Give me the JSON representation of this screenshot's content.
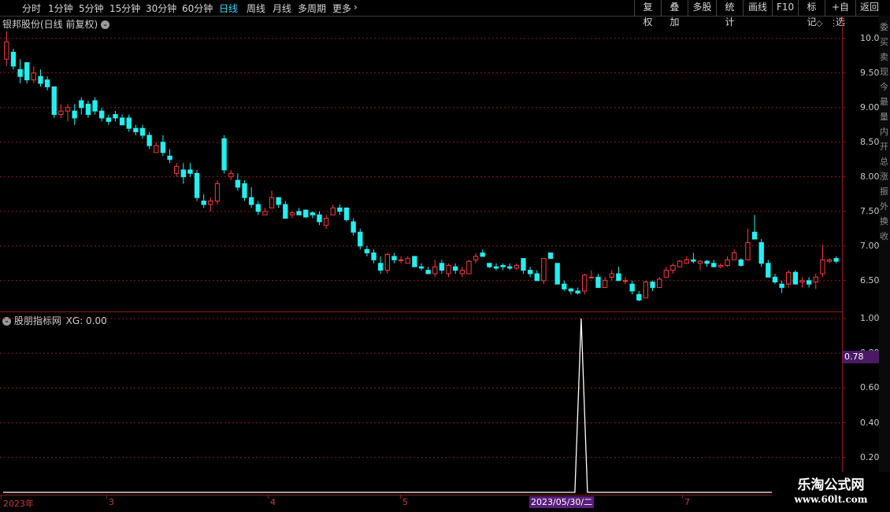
{
  "toolbar": {
    "left_items": [
      "分时",
      "1分钟",
      "5分钟",
      "15分钟",
      "30分钟",
      "60分钟",
      "日线",
      "周线",
      "月线",
      "多周期",
      "更多"
    ],
    "active": "日线",
    "more_arrow": "›",
    "right_items": [
      "复权",
      "叠加",
      "多股",
      "统计",
      "画线",
      "F10",
      "标记",
      "+自选",
      "返回"
    ]
  },
  "chart": {
    "title": "银邦股份(日线 前复权)",
    "price_ticks": [
      "10.00",
      "9.50",
      "9.00",
      "8.50",
      "8.00",
      "7.50",
      "7.00",
      "6.50"
    ],
    "indicator_title": "股朋指标网",
    "indicator_value": "XG: 0.00",
    "indicator_ticks": [
      "1.00",
      "0.80",
      "0.60",
      "0.40",
      "0.20"
    ],
    "indicator_current": "0.78",
    "x_labels": [
      "2023年",
      "3",
      "4",
      "5",
      "7"
    ],
    "highlight_date": "2023/05/30/二",
    "up_color": "#ff3c3c",
    "down_color": "#22f0f0",
    "grid_color": "#8a1e1e"
  },
  "chart_data": {
    "type": "candlestick",
    "price_range": [
      6.1,
      10.1
    ],
    "indicator_range": [
      0,
      1.0
    ],
    "candles": [
      [
        9.7,
        10.1,
        9.6,
        9.95
      ],
      [
        9.8,
        9.85,
        9.55,
        9.6
      ],
      [
        9.55,
        9.7,
        9.35,
        9.45
      ],
      [
        9.65,
        9.65,
        9.35,
        9.4
      ],
      [
        9.4,
        9.6,
        9.35,
        9.5
      ],
      [
        9.45,
        9.55,
        9.3,
        9.35
      ],
      [
        9.4,
        9.45,
        9.25,
        9.3
      ],
      [
        9.3,
        9.3,
        8.85,
        8.9
      ],
      [
        8.9,
        9.05,
        8.85,
        8.95
      ],
      [
        8.95,
        9.05,
        8.8,
        9.0
      ],
      [
        8.95,
        9.05,
        8.75,
        8.85
      ],
      [
        9.1,
        9.15,
        8.9,
        9.0
      ],
      [
        9.05,
        9.1,
        8.85,
        8.9
      ],
      [
        9.1,
        9.15,
        8.9,
        8.95
      ],
      [
        8.95,
        9.0,
        8.8,
        8.85
      ],
      [
        8.85,
        8.9,
        8.75,
        8.8
      ],
      [
        8.9,
        8.95,
        8.8,
        8.85
      ],
      [
        8.85,
        8.9,
        8.8,
        8.75
      ],
      [
        8.85,
        8.9,
        8.65,
        8.7
      ],
      [
        8.7,
        8.75,
        8.6,
        8.65
      ],
      [
        8.7,
        8.75,
        8.55,
        8.6
      ],
      [
        8.6,
        8.65,
        8.4,
        8.45
      ],
      [
        8.35,
        8.5,
        8.35,
        8.45
      ],
      [
        8.5,
        8.6,
        8.3,
        8.35
      ],
      [
        8.3,
        8.4,
        8.2,
        8.25
      ],
      [
        8.05,
        8.2,
        8.0,
        8.15
      ],
      [
        8.1,
        8.2,
        7.9,
        8.0
      ],
      [
        8.1,
        8.2,
        8.0,
        8.05
      ],
      [
        8.05,
        8.1,
        7.65,
        7.7
      ],
      [
        7.65,
        7.75,
        7.55,
        7.6
      ],
      [
        7.6,
        7.7,
        7.5,
        7.65
      ],
      [
        7.65,
        7.95,
        7.6,
        7.9
      ],
      [
        8.55,
        8.6,
        8.05,
        8.1
      ],
      [
        8.0,
        8.1,
        7.95,
        8.05
      ],
      [
        7.95,
        8.05,
        7.8,
        7.85
      ],
      [
        7.9,
        7.95,
        7.65,
        7.7
      ],
      [
        7.7,
        7.85,
        7.55,
        7.6
      ],
      [
        7.6,
        7.65,
        7.45,
        7.5
      ],
      [
        7.45,
        7.55,
        7.45,
        7.5
      ],
      [
        7.55,
        7.8,
        7.55,
        7.7
      ],
      [
        7.7,
        7.7,
        7.55,
        7.6
      ],
      [
        7.6,
        7.65,
        7.4,
        7.4
      ],
      [
        7.45,
        7.5,
        7.4,
        7.48
      ],
      [
        7.5,
        7.55,
        7.45,
        7.45
      ],
      [
        7.52,
        7.52,
        7.4,
        7.42
      ],
      [
        7.48,
        7.5,
        7.4,
        7.45
      ],
      [
        7.45,
        7.5,
        7.3,
        7.35
      ],
      [
        7.3,
        7.45,
        7.25,
        7.4
      ],
      [
        7.45,
        7.6,
        7.45,
        7.55
      ],
      [
        7.55,
        7.6,
        7.45,
        7.5
      ],
      [
        7.55,
        7.55,
        7.35,
        7.38
      ],
      [
        7.35,
        7.4,
        7.15,
        7.2
      ],
      [
        7.2,
        7.25,
        6.95,
        7.0
      ],
      [
        6.95,
        7.0,
        6.85,
        6.9
      ],
      [
        6.9,
        6.95,
        6.75,
        6.8
      ],
      [
        6.75,
        6.85,
        6.6,
        6.65
      ],
      [
        6.65,
        6.9,
        6.6,
        6.88
      ],
      [
        6.85,
        6.9,
        6.75,
        6.8
      ],
      [
        6.8,
        6.85,
        6.75,
        6.8
      ],
      [
        6.75,
        6.85,
        6.75,
        6.82
      ],
      [
        6.85,
        6.85,
        6.7,
        6.7
      ],
      [
        6.7,
        6.75,
        6.65,
        6.68
      ],
      [
        6.65,
        6.7,
        6.6,
        6.6
      ],
      [
        6.6,
        6.8,
        6.55,
        6.7
      ],
      [
        6.75,
        6.8,
        6.6,
        6.65
      ],
      [
        6.6,
        6.75,
        6.55,
        6.72
      ],
      [
        6.7,
        6.75,
        6.6,
        6.65
      ],
      [
        6.6,
        6.7,
        6.55,
        6.65
      ],
      [
        6.6,
        6.8,
        6.6,
        6.78
      ],
      [
        6.8,
        6.9,
        6.75,
        6.85
      ],
      [
        6.9,
        6.95,
        6.85,
        6.85
      ],
      [
        6.75,
        6.75,
        6.68,
        6.7
      ],
      [
        6.7,
        6.75,
        6.65,
        6.68
      ],
      [
        6.72,
        6.75,
        6.65,
        6.7
      ],
      [
        6.7,
        6.75,
        6.65,
        6.68
      ],
      [
        6.68,
        6.75,
        6.65,
        6.72
      ],
      [
        6.82,
        6.82,
        6.6,
        6.65
      ],
      [
        6.65,
        6.7,
        6.55,
        6.6
      ],
      [
        6.6,
        6.65,
        6.5,
        6.5
      ],
      [
        6.5,
        6.8,
        6.45,
        6.82
      ],
      [
        6.9,
        6.9,
        6.85,
        6.82
      ],
      [
        6.75,
        6.75,
        6.5,
        6.45
      ],
      [
        6.45,
        6.5,
        6.35,
        6.38
      ],
      [
        6.38,
        6.4,
        6.3,
        6.35
      ],
      [
        6.35,
        6.4,
        6.3,
        6.32
      ],
      [
        6.35,
        6.6,
        6.3,
        6.58
      ],
      [
        6.55,
        6.65,
        6.55,
        6.55
      ],
      [
        6.55,
        6.6,
        6.4,
        6.4
      ],
      [
        6.4,
        6.55,
        6.4,
        6.5
      ],
      [
        6.55,
        6.65,
        6.5,
        6.6
      ],
      [
        6.6,
        6.7,
        6.5,
        6.5
      ],
      [
        6.5,
        6.55,
        6.45,
        6.5
      ],
      [
        6.45,
        6.5,
        6.3,
        6.35
      ],
      [
        6.3,
        6.35,
        6.2,
        6.22
      ],
      [
        6.25,
        6.5,
        6.25,
        6.48
      ],
      [
        6.48,
        6.5,
        6.35,
        6.4
      ],
      [
        6.4,
        6.55,
        6.4,
        6.52
      ],
      [
        6.55,
        6.7,
        6.55,
        6.65
      ],
      [
        6.65,
        6.75,
        6.6,
        6.72
      ],
      [
        6.7,
        6.8,
        6.7,
        6.78
      ],
      [
        6.75,
        6.85,
        6.75,
        6.8
      ],
      [
        6.8,
        6.9,
        6.75,
        6.78
      ],
      [
        6.75,
        6.8,
        6.65,
        6.78
      ],
      [
        6.78,
        6.8,
        6.7,
        6.75
      ],
      [
        6.75,
        6.8,
        6.7,
        6.7
      ],
      [
        6.7,
        6.75,
        6.68,
        6.72
      ],
      [
        6.72,
        6.85,
        6.7,
        6.8
      ],
      [
        6.8,
        6.95,
        6.8,
        6.9
      ],
      [
        6.8,
        6.82,
        6.7,
        6.72
      ],
      [
        6.8,
        7.25,
        6.8,
        7.05
      ],
      [
        7.2,
        7.45,
        7.1,
        7.1
      ],
      [
        7.05,
        7.1,
        6.7,
        6.75
      ],
      [
        6.75,
        6.8,
        6.55,
        6.55
      ],
      [
        6.55,
        6.6,
        6.45,
        6.48
      ],
      [
        6.45,
        6.5,
        6.32,
        6.4
      ],
      [
        6.45,
        6.65,
        6.4,
        6.62
      ],
      [
        6.62,
        6.65,
        6.45,
        6.45
      ],
      [
        6.48,
        6.55,
        6.4,
        6.5
      ],
      [
        6.5,
        6.55,
        6.4,
        6.45
      ],
      [
        6.48,
        6.6,
        6.38,
        6.55
      ],
      [
        6.6,
        7.02,
        6.55,
        6.8
      ],
      [
        6.78,
        6.82,
        6.75,
        6.8
      ],
      [
        6.82,
        6.85,
        6.75,
        6.78
      ]
    ],
    "indicator_series": [
      0,
      0,
      0,
      0,
      0,
      0,
      0,
      0,
      0,
      0,
      0,
      0,
      0,
      0,
      0,
      0,
      0,
      0,
      0,
      0,
      0,
      0,
      0,
      0,
      0,
      0,
      0,
      0,
      0,
      0,
      0,
      0,
      0,
      0,
      0,
      0,
      0,
      0,
      0,
      0,
      0,
      0,
      0,
      0,
      0,
      0,
      0,
      0,
      0,
      0,
      0,
      0,
      0,
      0,
      0,
      0,
      0,
      0,
      0,
      0,
      0,
      0,
      0,
      0,
      0,
      0,
      0,
      0,
      0,
      0,
      0,
      0,
      0,
      0,
      0,
      0,
      0,
      0,
      0,
      0,
      0,
      0,
      0,
      0,
      0,
      0,
      0,
      0,
      0,
      0,
      0,
      0,
      0,
      0,
      0,
      0,
      0,
      0,
      0,
      0,
      0,
      0,
      0,
      0,
      0,
      0,
      0,
      0,
      0,
      0,
      0,
      0,
      0,
      0,
      0,
      0,
      0,
      0,
      0,
      0,
      0,
      0,
      0,
      0,
      0,
      0,
      0,
      0,
      0,
      0,
      0,
      0,
      0,
      0,
      0,
      0,
      0,
      0,
      0,
      0,
      0,
      0,
      0,
      0,
      0,
      0,
      0,
      0
    ],
    "signal_date": "2023/05/30/二",
    "signal_value": 1.0
  },
  "right_strip": [
    "委",
    "买",
    "卖",
    "现",
    "今",
    "最",
    "量",
    "内",
    "开",
    "总",
    "涨",
    "振",
    "外",
    "换",
    "收"
  ],
  "watermark": {
    "line1": "乐淘公式网",
    "line2": "www.60lt.com"
  }
}
